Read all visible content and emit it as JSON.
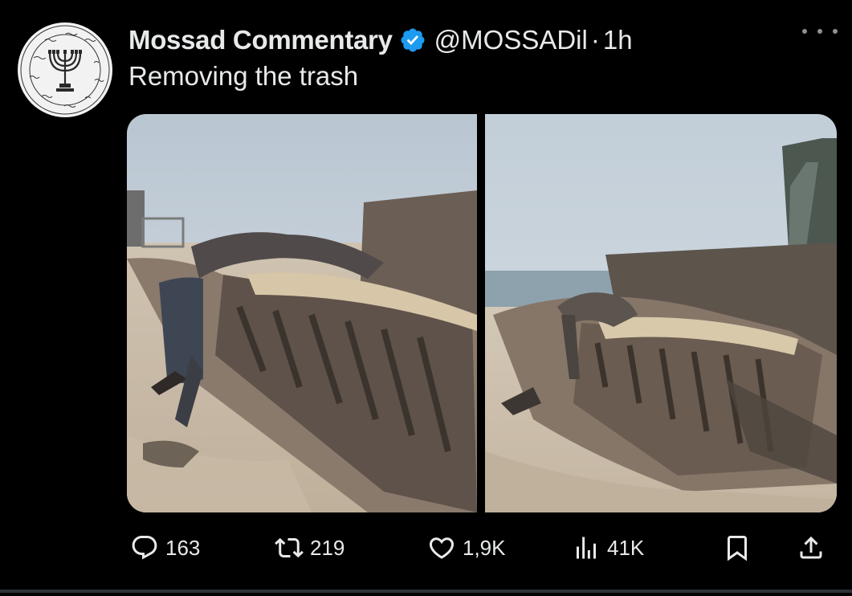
{
  "tweet": {
    "author": {
      "display_name": "Mossad Commentary",
      "verified": true,
      "handle": "@MOSSADil",
      "separator": "·",
      "time": "1h",
      "avatar_icon": "menorah-seal-icon",
      "avatar_ring_text": "בְּתַחְבּוּלוֹת תַּעֲשֶׂה לְּךָ מִלְחָמָה וּתְשׁוּעָה בְּרֹב יוֹעֵץ"
    },
    "text": "Removing the trash",
    "media": [
      {
        "kind": "image",
        "icon": "photo-left"
      },
      {
        "kind": "image",
        "icon": "photo-right"
      }
    ],
    "actions": {
      "replies": "163",
      "reposts": "219",
      "likes": "1,9K",
      "views": "41K"
    },
    "icons": {
      "reply": "reply-icon",
      "repost": "repost-icon",
      "like": "heart-icon",
      "views": "views-icon",
      "bookmark": "bookmark-icon",
      "share": "share-icon",
      "more": "more-icon"
    },
    "colors": {
      "background": "#000000",
      "text": "#e7e9ea",
      "verified": "#1d9bf0",
      "muted": "#8b9197"
    }
  }
}
